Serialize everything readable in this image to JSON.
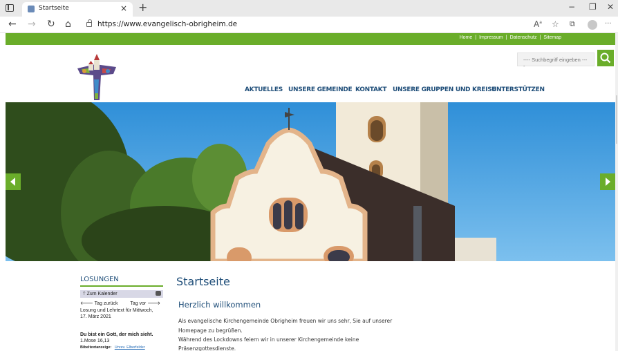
{
  "browser": {
    "tab_title": "Startseite",
    "tab_close": "×",
    "new_tab": "+",
    "url": "https://www.evangelisch-obrigheim.de",
    "minimize": "−",
    "maximize": "❐",
    "close": "✕",
    "back": "←",
    "forward": "→",
    "reload": "↻",
    "home": "⌂",
    "icons": [
      "read-aloud-icon",
      "favorites-icon",
      "collections-icon",
      "profile-icon",
      "more-icon"
    ]
  },
  "top_links": [
    "Home",
    "Impressum",
    "Datenschutz",
    "Sitemap"
  ],
  "top_links_separator": "|",
  "search": {
    "placeholder": "---- Suchbegriff eingeben ----"
  },
  "nav": [
    "AKTUELLES",
    "UNSERE GEMEINDE",
    "KONTAKT",
    "UNSERE GRUPPEN UND KREISE",
    "UNTERSTÜTZEN"
  ],
  "losungen": {
    "title": "LOSUNGEN",
    "calendar_link": "Zum Kalender",
    "prev_day": "Tag zurück",
    "next_day": "Tag vor",
    "date_line1": "Losung und Lehrtext für Mittwoch,",
    "date_line2": "17. März 2021",
    "verse": "Du bist ein Gott, der mich sieht.",
    "reference": "1.Mose 16,13",
    "bible_label": "Bibeltextanzeige:",
    "bible_link": "Unrev. Elberfelder"
  },
  "content": {
    "page_title": "Startseite",
    "heading": "Herzlich willkommen",
    "lines": [
      "Als evangelische Kirchengemeinde Obrigheim freuen wir uns sehr, Sie auf unserer",
      "Homepage zu begrüßen.",
      "Während des Lockdowns feiern wir in unserer Kirchengemeinde keine",
      "Präsenzgottesdienste."
    ]
  },
  "colors": {
    "green": "#6aad2a",
    "navy": "#1f4e79"
  }
}
